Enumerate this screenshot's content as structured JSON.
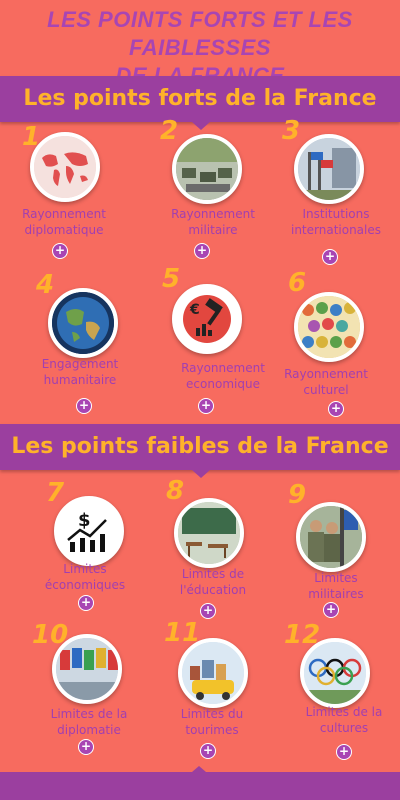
{
  "title": {
    "line1": "LES POINTS FORTS ET LES FAIBLESSES",
    "line2": "DE LA FRANCE"
  },
  "strengths_banner": "Les points forts de la France",
  "weaknesses_banner": "Les points faibles de la France",
  "plus_symbol": "+",
  "strengths": [
    {
      "num": "1",
      "label": "Rayonnement\ndiplomatique",
      "icon": "world-map-icon"
    },
    {
      "num": "2",
      "label": "Rayonnement\nmilitaire",
      "icon": "military-parade-icon"
    },
    {
      "num": "3",
      "label": "Institutions\ninternationales",
      "icon": "flags-building-icon"
    },
    {
      "num": "4",
      "label": "Engagement\nhumanitaire",
      "icon": "globe-icon"
    },
    {
      "num": "5",
      "label": "Rayonnement\neconomique",
      "icon": "gavel-euro-icon"
    },
    {
      "num": "6",
      "label": "Rayonnement\nculturel",
      "icon": "crowd-icon"
    }
  ],
  "weaknesses": [
    {
      "num": "7",
      "label": "Limites\néconomiques",
      "icon": "dollar-chart-icon"
    },
    {
      "num": "8",
      "label": "Limites de\nl'éducation",
      "icon": "classroom-icon"
    },
    {
      "num": "9",
      "label": "Limites\nmilitaires",
      "icon": "soldiers-icon"
    },
    {
      "num": "10",
      "label": "Limites de la\ndiplomatie",
      "icon": "flags-icon"
    },
    {
      "num": "11",
      "label": "Limites du\ntourimes",
      "icon": "tourism-car-icon"
    },
    {
      "num": "12",
      "label": "Limites de la\ncultures",
      "icon": "olympic-rings-icon"
    }
  ],
  "colors": {
    "background": "#f76b5f",
    "banner": "#9b3f9f",
    "accent_orange": "#ffb22a",
    "label_purple": "#a23fb0"
  }
}
